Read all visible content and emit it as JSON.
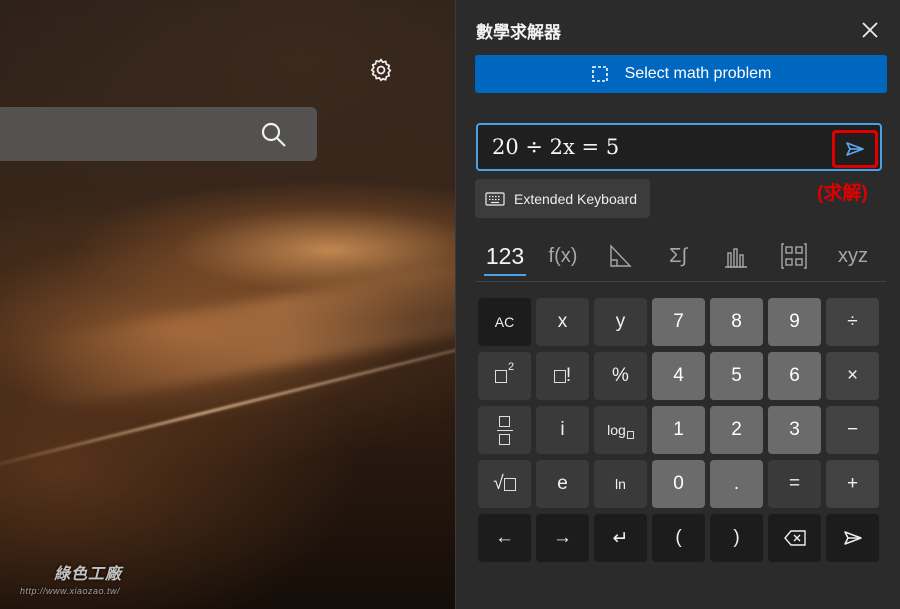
{
  "background": {
    "settings_icon": "gear-icon",
    "search_icon": "search-icon",
    "watermark": {
      "logo_text": "綠色工廠",
      "url": "http://www.xiaozao.tw/"
    }
  },
  "panel": {
    "title": "數學求解器",
    "close_icon": "close-icon",
    "select_button": {
      "label": "Select math problem",
      "icon": "screen-select-icon"
    },
    "input": {
      "value": "20 ÷ 2x = 5"
    },
    "solve_icon": "send-arrow-icon",
    "solve_annotation": "(求解)",
    "extended_keyboard": {
      "label": "Extended Keyboard",
      "icon": "keyboard-icon"
    },
    "tabs": [
      {
        "label": "123",
        "active": true
      },
      {
        "label": "f(x)",
        "active": false
      },
      {
        "label": "triangle-icon",
        "active": false
      },
      {
        "label": "Σ∫",
        "active": false
      },
      {
        "label": "bar-chart-icon",
        "active": false
      },
      {
        "label": "matrix-icon",
        "active": false
      },
      {
        "label": "xyz",
        "active": false
      }
    ]
  },
  "keypad": {
    "row1": [
      "AC",
      "x",
      "y",
      "7",
      "8",
      "9",
      "÷"
    ],
    "row2": [
      "□²",
      "□!",
      "%",
      "4",
      "5",
      "6",
      "×"
    ],
    "row3": [
      "fraction",
      "i",
      "log□",
      "1",
      "2",
      "3",
      "−"
    ],
    "row4": [
      "√□",
      "e",
      "ln",
      "0",
      ".",
      "=",
      "+"
    ],
    "row5": [
      "←",
      "→",
      "↵",
      "(",
      ")",
      "⌫",
      "➤"
    ],
    "labels": {
      "ac": "AC",
      "x": "x",
      "y": "y",
      "seven": "7",
      "eight": "8",
      "nine": "9",
      "divide": "÷",
      "square_sup": "2",
      "factorial": "!",
      "percent": "%",
      "four": "4",
      "five": "5",
      "six": "6",
      "multiply": "×",
      "i": "i",
      "log": "log",
      "one": "1",
      "two": "2",
      "three": "3",
      "minus": "−",
      "sqrt": "√",
      "e": "e",
      "ln": "ln",
      "zero": "0",
      "dot": ".",
      "equals": "=",
      "plus": "+",
      "left": "←",
      "right": "→",
      "enter": "↵",
      "lparen": "(",
      "rparen": ")"
    }
  },
  "colors": {
    "accent": "#0067c0",
    "focus_border": "#4ba0e6",
    "annotation_red": "#e00000",
    "panel_bg": "#2b2b2b"
  }
}
